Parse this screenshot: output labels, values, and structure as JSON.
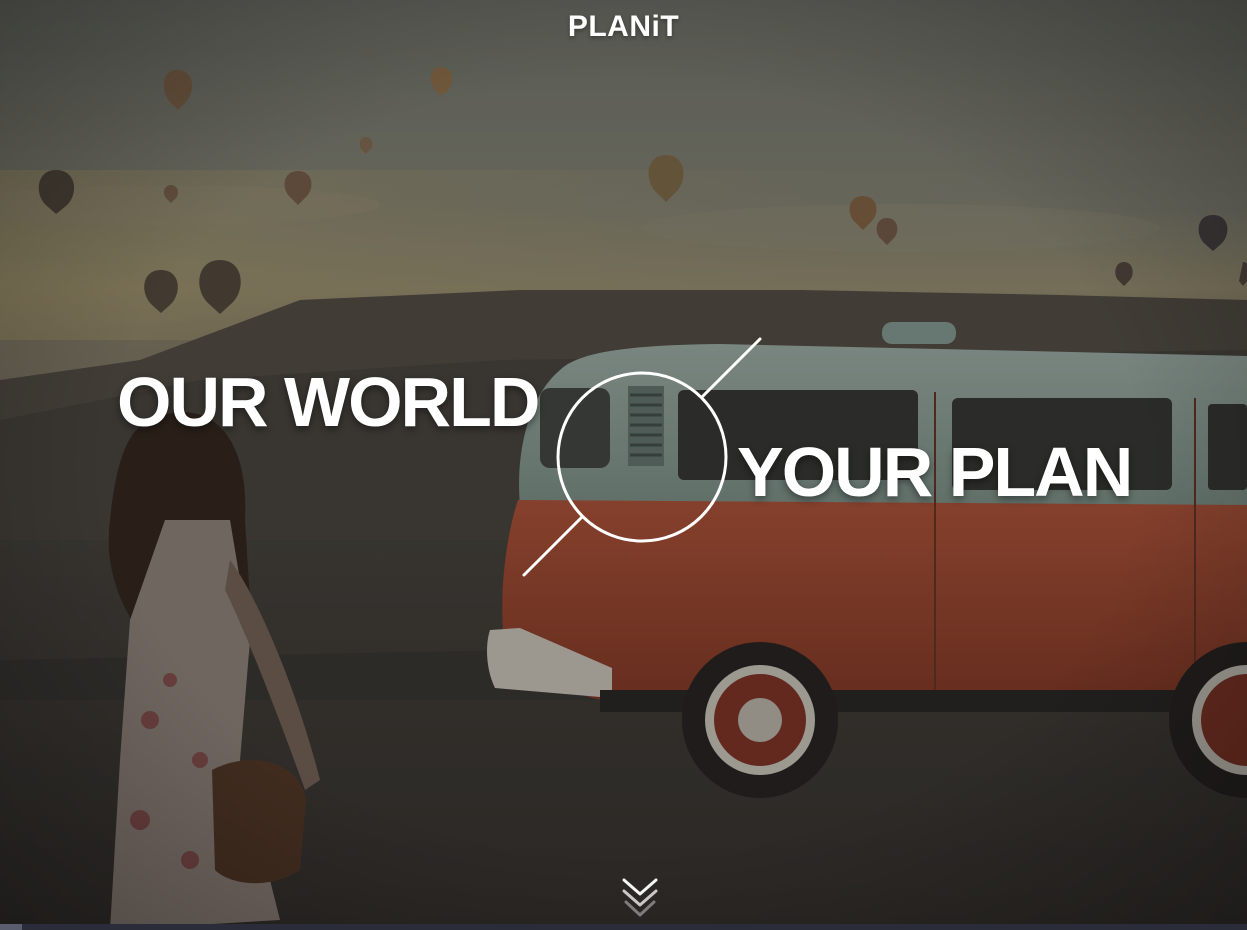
{
  "header": {
    "brand": "PLANiT"
  },
  "hero": {
    "headline_left": "OUR WORLD",
    "headline_right": "YOUR PLAN",
    "background_scene": "hot-air-balloons-van-sunset-photo",
    "scroll_icon": "double-chevron-down-icon"
  },
  "colors": {
    "text": "#ffffff",
    "van_orange": "#b8553a",
    "van_teal": "#9fb5ad",
    "sky": "#8a8b7f",
    "overlay_dark": "#3a3937"
  }
}
